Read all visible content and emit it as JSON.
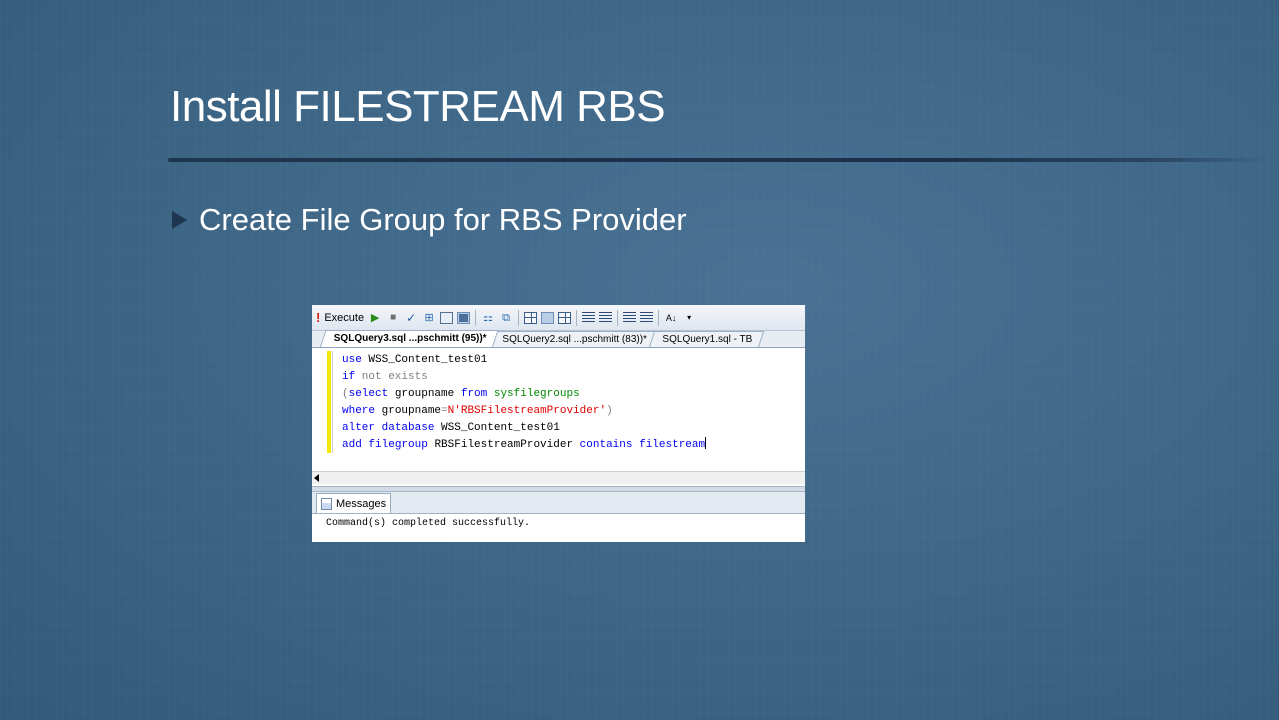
{
  "slide": {
    "title": "Install FILESTREAM RBS",
    "bullet": "Create File Group for RBS Provider"
  },
  "toolbar": {
    "execute_label": "Execute"
  },
  "tabs": [
    {
      "label": "SQLQuery3.sql ...pschmitt (95))*",
      "active": true
    },
    {
      "label": "SQLQuery2.sql ...pschmitt (83))*",
      "active": false
    },
    {
      "label": "SQLQuery1.sql - TB",
      "active": false
    }
  ],
  "editor": {
    "lines": [
      [
        {
          "t": "use",
          "c": "kw"
        },
        {
          "t": " WSS_Content_test01",
          "c": ""
        }
      ],
      [
        {
          "t": "if",
          "c": "kw"
        },
        {
          "t": " not exists",
          "c": "gray"
        }
      ],
      [
        {
          "t": "(",
          "c": "gray"
        },
        {
          "t": "select",
          "c": "kw"
        },
        {
          "t": " groupname ",
          "c": ""
        },
        {
          "t": "from",
          "c": "kw"
        },
        {
          "t": " sysfilegroups",
          "c": "fn"
        }
      ],
      [
        {
          "t": "where",
          "c": "kw"
        },
        {
          "t": " groupname",
          "c": ""
        },
        {
          "t": "=",
          "c": "gray"
        },
        {
          "t": "N'RBSFilestreamProvider'",
          "c": "str"
        },
        {
          "t": ")",
          "c": "gray"
        }
      ],
      [
        {
          "t": "alter",
          "c": "kw"
        },
        {
          "t": " ",
          "c": ""
        },
        {
          "t": "database",
          "c": "kw"
        },
        {
          "t": " WSS_Content_test01",
          "c": ""
        }
      ],
      [
        {
          "t": "add",
          "c": "kw"
        },
        {
          "t": " ",
          "c": ""
        },
        {
          "t": "filegroup",
          "c": "kw"
        },
        {
          "t": " RBSFilestreamProvider ",
          "c": ""
        },
        {
          "t": "contains",
          "c": "kw"
        },
        {
          "t": " ",
          "c": ""
        },
        {
          "t": "filestream",
          "c": "kw"
        }
      ]
    ]
  },
  "results": {
    "tab_label": "Messages",
    "message": "Command(s) completed successfully."
  },
  "colors": {
    "keyword": "#0000f0",
    "string": "#e00000",
    "system_object": "#008a00",
    "operator": "#808080",
    "slide_background": "#3f6787"
  }
}
